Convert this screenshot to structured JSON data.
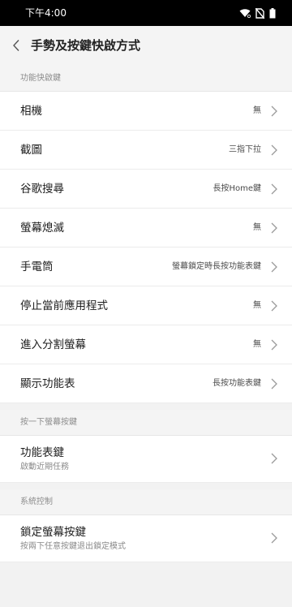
{
  "status_bar": {
    "time": "下午4:00",
    "icons": [
      "wifi-icon",
      "no-sim-icon",
      "battery-icon"
    ]
  },
  "app_bar": {
    "title": "手勢及按鍵快啟方式",
    "back_icon": "chevron-left-icon"
  },
  "sections": [
    {
      "header": "功能快啟鍵",
      "items": [
        {
          "label": "相機",
          "value": "無"
        },
        {
          "label": "截圖",
          "value": "三指下拉"
        },
        {
          "label": "谷歌搜尋",
          "value": "長按Home鍵"
        },
        {
          "label": "螢幕熄滅",
          "value": "無"
        },
        {
          "label": "手電筒",
          "value": "螢幕鎖定時長按功能表鍵"
        },
        {
          "label": "停止當前應用程式",
          "value": "無"
        },
        {
          "label": "進入分割螢幕",
          "value": "無"
        },
        {
          "label": "顯示功能表",
          "value": "長按功能表鍵"
        }
      ]
    },
    {
      "header": "按一下螢幕按鍵",
      "items": [
        {
          "label": "功能表鍵",
          "subtitle": "啟動近期任務"
        }
      ]
    },
    {
      "header": "系統控制",
      "items": [
        {
          "label": "鎖定螢幕按鍵",
          "subtitle": "按兩下任意按鍵退出鎖定模式"
        }
      ]
    }
  ],
  "colors": {
    "status_bar_bg": "#000000",
    "background": "#f2f2f2",
    "row_bg": "#ffffff",
    "section_text": "#8c8c8c"
  }
}
